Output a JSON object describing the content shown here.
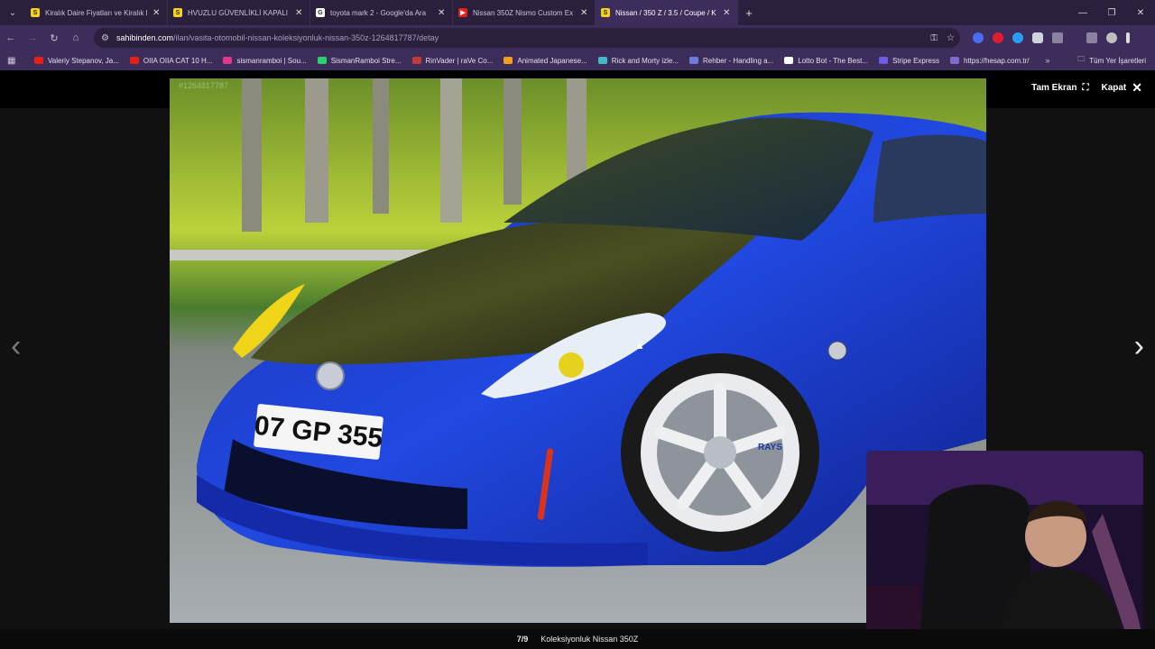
{
  "browser": {
    "tabs": [
      {
        "title": "Kiralık Daire Fiyatları ve Kiralık E",
        "favicon": "sahibinden-icon",
        "fav_color": "#f7d21a",
        "fav_letter": "S",
        "active": false
      },
      {
        "title": "HVUZLU GÜVENLİKLİ KAPALI O",
        "favicon": "sahibinden-icon",
        "fav_color": "#f7d21a",
        "fav_letter": "S",
        "active": false
      },
      {
        "title": "toyota mark 2 - Google'da Ara",
        "favicon": "google-icon",
        "fav_color": "#ffffff",
        "fav_letter": "G",
        "active": false
      },
      {
        "title": "Nissan 350Z Nismo Custom Ex",
        "favicon": "youtube-icon",
        "fav_color": "#e62117",
        "fav_letter": "▶",
        "active": false
      },
      {
        "title": "Nissan / 350 Z / 3.5 / Coupe / K",
        "favicon": "sahibinden-icon",
        "fav_color": "#f7d21a",
        "fav_letter": "S",
        "active": true
      }
    ],
    "url_host": "sahibinden.com",
    "url_path": "/ilan/vasita-otomobil-nissan-koleksiyonluk-nissan-350z-1264817787/detay",
    "bookmarks": [
      {
        "label": "Valeriy Stepanov, Ja...",
        "color": "#e62117"
      },
      {
        "label": "OIIA OIIA CAT 10 H...",
        "color": "#e62117"
      },
      {
        "label": "sismanramboi | Sou...",
        "color": "#e3378a"
      },
      {
        "label": "SismanRamboi Stre...",
        "color": "#2bd16a"
      },
      {
        "label": "RinVader | raVe Co...",
        "color": "#c33a3a"
      },
      {
        "label": "Animated Japanese...",
        "color": "#f2a11c"
      },
      {
        "label": "Rick and Morty izle...",
        "color": "#42b8c8"
      },
      {
        "label": "Rehber - Handling a...",
        "color": "#6d7bd9"
      },
      {
        "label": "Lotto Bot - The Best...",
        "color": "#ffffff"
      },
      {
        "label": "Stripe Express",
        "color": "#6b5be6"
      },
      {
        "label": "https://hesap.com.tr/",
        "color": "#7e6bd0"
      }
    ],
    "all_bookmarks": "Tüm Yer İşaretleri"
  },
  "viewer": {
    "fullscreen_label": "Tam Ekran",
    "close_label": "Kapat",
    "photo_id": "#1264817787",
    "counter": "7/9",
    "caption": "Koleksiyonluk Nissan 350Z",
    "plate": "07 GP 355",
    "wheel_brand": "RAYS"
  },
  "colors": {
    "car_blue": "#1f3fc7",
    "browser_purple": "#3c2d5a"
  }
}
